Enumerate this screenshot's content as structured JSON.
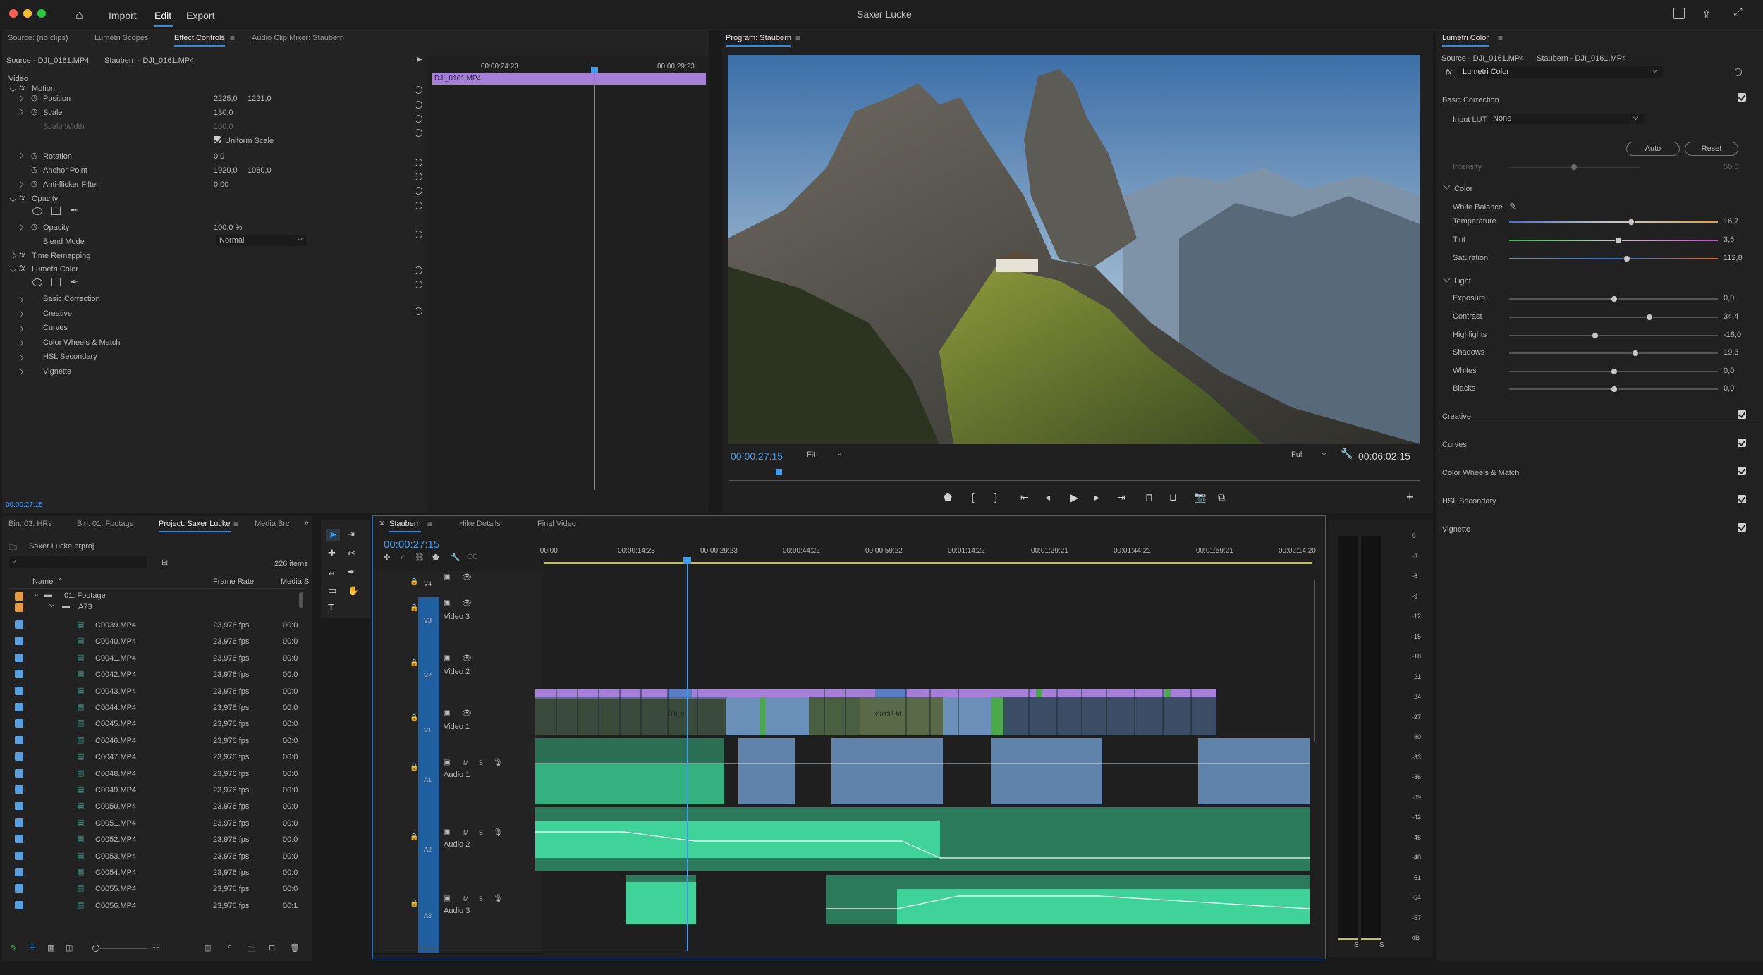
{
  "app": {
    "title": "Saxer Lucke",
    "menu": [
      "Import",
      "Edit",
      "Export"
    ],
    "active_menu": "Edit"
  },
  "source_panel": {
    "tabs": [
      "Source: (no clips)",
      "Lumetri Scopes",
      "Effect Controls",
      "Audio Clip Mixer: Staubern"
    ],
    "active_tab": "Effect Controls",
    "source_label": "Source - DJI_0161.MP4",
    "seq_label": "Staubern - DJI_0161.MP4",
    "ruler": [
      "00:00:24:23",
      "00:00:29:23"
    ],
    "clip_name": "DJI_0161.MP4",
    "timecode": "00:00:27:15",
    "section_video": "Video",
    "rows": [
      {
        "label": "Motion",
        "fx": true
      },
      {
        "label": "Position",
        "v1": "2225,0",
        "v2": "1221,0"
      },
      {
        "label": "Scale",
        "v1": "130,0"
      },
      {
        "label": "Scale Width",
        "v1": "100,0",
        "dim": true
      },
      {
        "label": "Uniform Scale"
      },
      {
        "label": "Rotation",
        "v1": "0,0"
      },
      {
        "label": "Anchor Point",
        "v1": "1920,0",
        "v2": "1080,0"
      },
      {
        "label": "Anti-flicker Filter",
        "v1": "0,00"
      },
      {
        "label": "Opacity",
        "fx": true
      },
      {
        "label": "Opacity",
        "v1": "100,0 %"
      },
      {
        "label": "Blend Mode",
        "v1": "Normal"
      },
      {
        "label": "Time Remapping",
        "fx": true
      },
      {
        "label": "Lumetri Color",
        "fx": true
      },
      {
        "label": "Basic Correction"
      },
      {
        "label": "Creative"
      },
      {
        "label": "Curves"
      },
      {
        "label": "Color Wheels & Match"
      },
      {
        "label": "HSL Secondary"
      },
      {
        "label": "Vignette"
      }
    ]
  },
  "program": {
    "title": "Program: Staubern",
    "timecode": "00:00:27:15",
    "fit": "Fit",
    "quality": "Full",
    "duration": "00:06:02:15"
  },
  "lumetri": {
    "title": "Lumetri Color",
    "source": "Source - DJI_0161.MP4",
    "seq": "Staubern - DJI_0161.MP4",
    "effect": "Lumetri Color",
    "basic": "Basic Correction",
    "input_lut_label": "Input LUT",
    "input_lut": "None",
    "auto": "Auto",
    "reset": "Reset",
    "intensity_label": "Intensity",
    "intensity": "50,0",
    "color_section": "Color",
    "white_balance": "White Balance",
    "light_section": "Light",
    "sliders": [
      {
        "label": "Temperature",
        "value": "16,7",
        "pos": 0.58
      },
      {
        "label": "Tint",
        "value": "3,6",
        "pos": 0.52
      },
      {
        "label": "Saturation",
        "value": "112,8",
        "pos": 0.56
      },
      {
        "label": "Exposure",
        "value": "0,0",
        "pos": 0.5
      },
      {
        "label": "Contrast",
        "value": "34,4",
        "pos": 0.67
      },
      {
        "label": "Highlights",
        "value": "-18,0",
        "pos": 0.41
      },
      {
        "label": "Shadows",
        "value": "19,3",
        "pos": 0.6
      },
      {
        "label": "Whites",
        "value": "0,0",
        "pos": 0.5
      },
      {
        "label": "Blacks",
        "value": "0,0",
        "pos": 0.5
      }
    ],
    "sections": [
      "Creative",
      "Curves",
      "Color Wheels & Match",
      "HSL Secondary",
      "Vignette"
    ]
  },
  "project": {
    "tabs": [
      "Bin: 03. HRs",
      "Bin: 01. Footage",
      "Project: Saxer Lucke",
      "Media Brc"
    ],
    "active_tab": "Project: Saxer Lucke",
    "file": "Saxer Lucke.prproj",
    "count": "226 items",
    "columns": [
      "Name",
      "Frame Rate",
      "Media S"
    ],
    "folder1": "01. Footage",
    "folder2": "A73",
    "files": [
      {
        "name": "C0039.MP4",
        "rate": "23,976 fps",
        "m": "00:0"
      },
      {
        "name": "C0040.MP4",
        "rate": "23,976 fps",
        "m": "00:0"
      },
      {
        "name": "C0041.MP4",
        "rate": "23,976 fps",
        "m": "00:0"
      },
      {
        "name": "C0042.MP4",
        "rate": "23,976 fps",
        "m": "00:0"
      },
      {
        "name": "C0043.MP4",
        "rate": "23,976 fps",
        "m": "00:0"
      },
      {
        "name": "C0044.MP4",
        "rate": "23,976 fps",
        "m": "00:0"
      },
      {
        "name": "C0045.MP4",
        "rate": "23,976 fps",
        "m": "00:0"
      },
      {
        "name": "C0046.MP4",
        "rate": "23,976 fps",
        "m": "00:0"
      },
      {
        "name": "C0047.MP4",
        "rate": "23,976 fps",
        "m": "00:0"
      },
      {
        "name": "C0048.MP4",
        "rate": "23,976 fps",
        "m": "00:0"
      },
      {
        "name": "C0049.MP4",
        "rate": "23,976 fps",
        "m": "00:0"
      },
      {
        "name": "C0050.MP4",
        "rate": "23,976 fps",
        "m": "00:0"
      },
      {
        "name": "C0051.MP4",
        "rate": "23,976 fps",
        "m": "00:0"
      },
      {
        "name": "C0052.MP4",
        "rate": "23,976 fps",
        "m": "00:0"
      },
      {
        "name": "C0053.MP4",
        "rate": "23,976 fps",
        "m": "00:0"
      },
      {
        "name": "C0054.MP4",
        "rate": "23,976 fps",
        "m": "00:0"
      },
      {
        "name": "C0055.MP4",
        "rate": "23,976 fps",
        "m": "00:0"
      },
      {
        "name": "C0056.MP4",
        "rate": "23,976 fps",
        "m": "00:1"
      }
    ]
  },
  "timeline": {
    "tabs": [
      "Staubern",
      "Hike Details",
      "Final Video"
    ],
    "active_tab": "Staubern",
    "timecode": "00:00:27:15",
    "ruler": [
      ":00:00",
      "00:00:14:23",
      "00:00:29:23",
      "00:00:44:22",
      "00:00:59:22",
      "00:01:14:22",
      "00:01:29:21",
      "00:01:44:21",
      "00:01:59:21",
      "00:02:14:20"
    ],
    "tracks": [
      {
        "id": "V4",
        "name": ""
      },
      {
        "id": "V3",
        "name": "Video 3"
      },
      {
        "id": "V2",
        "name": "Video 2"
      },
      {
        "id": "V1",
        "name": "Video 1"
      },
      {
        "id": "A1",
        "name": "Audio 1"
      },
      {
        "id": "A2",
        "name": "Audio 2"
      },
      {
        "id": "A3",
        "name": "Audio 3"
      }
    ],
    "clip_labels": [
      "DJI_0",
      "C0133.M"
    ]
  },
  "meter": {
    "scale": [
      "0",
      "-3",
      "-6",
      "-9",
      "-12",
      "-15",
      "-18",
      "-21",
      "-24",
      "-27",
      "-30",
      "-33",
      "-36",
      "-39",
      "-42",
      "-45",
      "-48",
      "-51",
      "-54",
      "-57",
      "dB"
    ],
    "solo": [
      "S",
      "S"
    ]
  },
  "colors": {
    "accent": "#2d8ceb",
    "fx": "#a680d8",
    "audio": "#2fbf8a",
    "video_clip": "#6a8fb8"
  }
}
